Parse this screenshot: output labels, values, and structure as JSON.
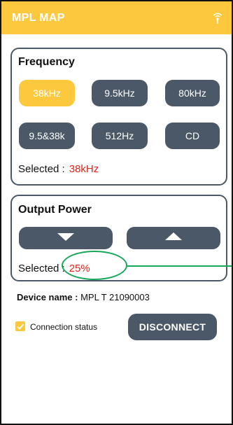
{
  "appbar": {
    "title": "MPL MAP",
    "icon": "signal-icon"
  },
  "frequency": {
    "title": "Frequency",
    "options": [
      "38kHz",
      "9.5kHz",
      "80kHz",
      "9.5&38k",
      "512Hz",
      "CD"
    ],
    "selected_index": 0,
    "selected_label": "Selected :",
    "selected_value": "38kHz"
  },
  "output_power": {
    "title": "Output Power",
    "decrease_icon": "arrow-down-icon",
    "increase_icon": "arrow-up-icon",
    "selected_label": "Selected :",
    "selected_value": "25%",
    "level_fraction": 0.25
  },
  "device": {
    "label": "Device name :",
    "name": "MPL T 21090003"
  },
  "connection": {
    "checked": true,
    "label": "Connection status"
  },
  "actions": {
    "disconnect_label": "DISCONNECT"
  },
  "colors": {
    "accent": "#fcc93e",
    "button": "#4b5868",
    "value_red": "#e0241b",
    "annotation_green": "#18a85a"
  }
}
